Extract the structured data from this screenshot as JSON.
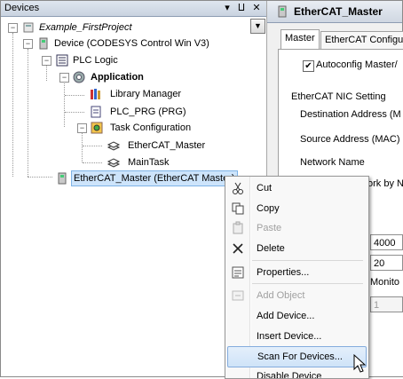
{
  "devices_panel": {
    "title": "Devices",
    "pin_glyph": "⨿",
    "close_glyph": "✕",
    "scroll_glyph": "▼",
    "tree": {
      "project": "Example_FirstProject",
      "device": "Device (CODESYS Control Win V3)",
      "plc_logic": "PLC Logic",
      "application": "Application",
      "library_manager": "Library Manager",
      "plc_prg": "PLC_PRG (PRG)",
      "task_configuration": "Task Configuration",
      "ethercat_master_task": "EtherCAT_Master",
      "main_task": "MainTask",
      "ethercat_master_device": "EtherCAT_Master (EtherCAT Master)"
    }
  },
  "editor_panel": {
    "title": "EtherCAT_Master",
    "tabs": [
      "Master",
      "EtherCAT Configu"
    ],
    "autoconfig_label": "Autoconfig Master/",
    "nic_group": "EtherCAT NIC Setting",
    "destination_address": "Destination Address (M",
    "source_address": "Source Address (MAC)",
    "network_name": "Network Name",
    "network_by": "ork by N",
    "field_4000": "4000",
    "field_20": "20",
    "monitor": "Monito",
    "field_1": "1"
  },
  "context_menu": {
    "items": [
      {
        "label": "Cut",
        "icon": "scissors-icon",
        "enabled": true
      },
      {
        "label": "Copy",
        "icon": "copy-icon",
        "enabled": true
      },
      {
        "label": "Paste",
        "icon": "paste-icon",
        "enabled": false
      },
      {
        "label": "Delete",
        "icon": "delete-icon",
        "enabled": true
      },
      {
        "label": "Properties...",
        "icon": "properties-icon",
        "enabled": true
      },
      {
        "label": "Add Object",
        "icon": "add-object-icon",
        "enabled": false
      },
      {
        "label": "Add Device...",
        "icon": "",
        "enabled": true
      },
      {
        "label": "Insert Device...",
        "icon": "",
        "enabled": true
      },
      {
        "label": "Scan For Devices...",
        "icon": "",
        "enabled": true,
        "highlighted": true
      },
      {
        "label": "Disable Device",
        "icon": "",
        "enabled": true
      }
    ]
  },
  "colors": {
    "selection": "#cde4fb",
    "menu_highlight": "#cfe3f8"
  }
}
